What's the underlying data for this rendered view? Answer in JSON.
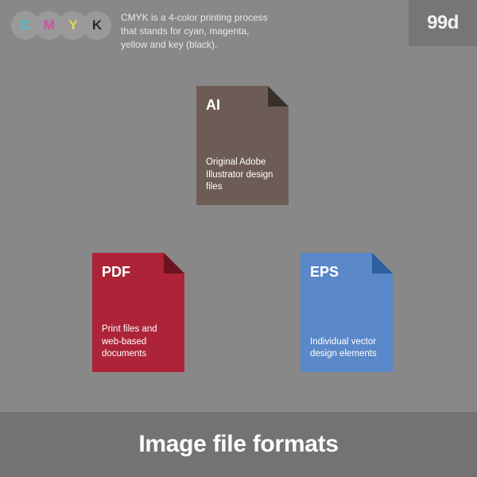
{
  "header": {
    "cmyk_letters": {
      "c": "C",
      "m": "M",
      "y": "Y",
      "k": "K"
    },
    "cmyk_description": "CMYK is a 4-color printing process that stands for cyan, magenta, yellow and key (black).",
    "logo_text": "99d"
  },
  "files": {
    "ai": {
      "label": "AI",
      "description": "Original Adobe Illustrator design files"
    },
    "pdf": {
      "label": "PDF",
      "description": "Print files and web-based documents"
    },
    "eps": {
      "label": "EPS",
      "description": "Individual vector design elements"
    }
  },
  "footer": {
    "title": "Image file formats"
  },
  "colors": {
    "bg": "#888888",
    "ai": "#6d5c56",
    "pdf": "#ad2438",
    "eps": "#5a88c8"
  }
}
